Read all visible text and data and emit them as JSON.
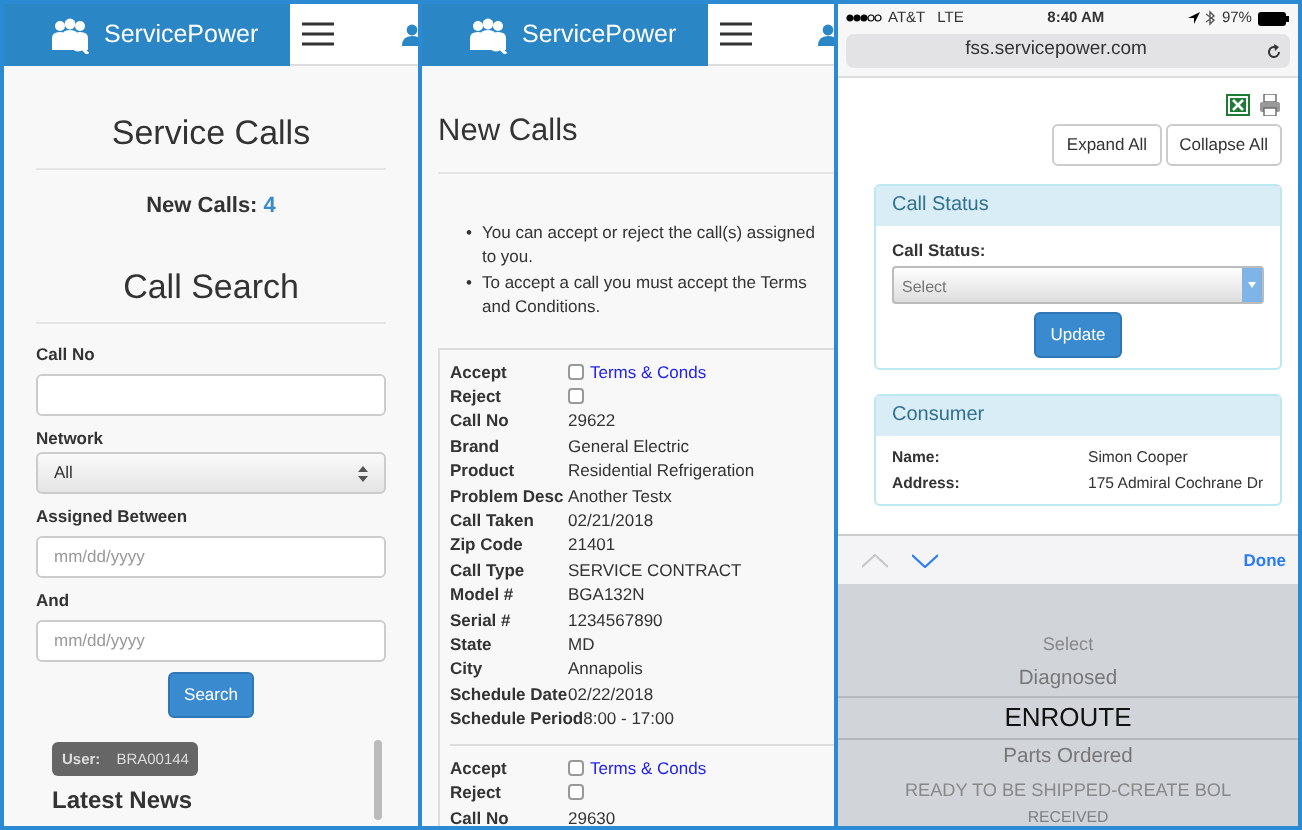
{
  "search_screen": {
    "brand": "ServicePower",
    "title": "Service Calls",
    "new_calls_label": "New Calls:",
    "new_calls_count": "4",
    "search_title": "Call Search",
    "fields": [
      {
        "kind": "text",
        "label": "Call No"
      },
      {
        "kind": "select",
        "label": "Network",
        "value": "All"
      },
      {
        "kind": "text",
        "label": "Assigned Between",
        "placeholder": "mm/dd/yyyy"
      },
      {
        "kind": "text",
        "label": "And",
        "placeholder": "mm/dd/yyyy"
      }
    ],
    "search_button": "Search",
    "user_label": "User:",
    "user_value": "BRA00144",
    "news_title": "Latest News"
  },
  "new_calls_screen": {
    "brand": "ServicePower",
    "title": "New Calls",
    "notes": [
      {
        "marker": "•",
        "text": "You can accept or reject the call(s) assigned to you."
      },
      {
        "marker": "•",
        "text": "To accept a call you must accept the Terms and Conditions."
      }
    ],
    "calls": [
      {
        "accept_label": "Accept",
        "accept_checked": false,
        "terms_link": "Terms & Conds",
        "reject_label": "Reject",
        "reject_checked": false,
        "details": [
          {
            "label": "Call No",
            "value": "29622"
          },
          {
            "label": "Brand",
            "value": "General Electric"
          },
          {
            "label": "Product",
            "value": "Residential Refrigeration"
          },
          {
            "label": "Problem Desc",
            "value": "Another Testx"
          },
          {
            "label": "Call Taken",
            "value": "02/21/2018"
          },
          {
            "label": "Zip Code",
            "value": "21401"
          },
          {
            "label": "Call Type",
            "value": "SERVICE CONTRACT"
          },
          {
            "label": "Model #",
            "value": "BGA132N"
          },
          {
            "label": "Serial #",
            "value": "1234567890"
          },
          {
            "label": "State",
            "value": "MD"
          },
          {
            "label": "City",
            "value": "Annapolis"
          },
          {
            "label": "Schedule Date",
            "value": "02/22/2018"
          },
          {
            "label": "Schedule Period",
            "value": "8:00 - 17:00"
          }
        ]
      },
      {
        "accept_label": "Accept",
        "accept_checked": false,
        "terms_link": "Terms & Conds",
        "reject_label": "Reject",
        "reject_checked": false,
        "details": [
          {
            "label": "Call No",
            "value": "29630"
          }
        ]
      }
    ]
  },
  "status_screen": {
    "carrier": "AT&T",
    "network": "LTE",
    "time": "8:40 AM",
    "battery": "97%",
    "url": "fss.servicepower.com",
    "buttons": [
      "Expand All",
      "Collapse All"
    ],
    "call_status_card": {
      "title": "Call Status",
      "label": "Call Status:",
      "select_value": "Select",
      "update_button": "Update"
    },
    "consumer_card": {
      "title": "Consumer",
      "rows": [
        {
          "label": "Name:",
          "value": "Simon Cooper"
        },
        {
          "label": "Address:",
          "value": "175 Admiral Cochrane Dr"
        }
      ]
    },
    "picker": {
      "prev_disabled": true,
      "next_disabled": false,
      "done": "Done",
      "options": [
        {
          "label": "Select",
          "selected": false
        },
        {
          "label": "Diagnosed",
          "selected": false
        },
        {
          "label": "ENROUTE",
          "selected": true
        },
        {
          "label": "Parts Ordered",
          "selected": false
        },
        {
          "label": "READY TO BE SHIPPED-CREATE BOL",
          "selected": false
        },
        {
          "label": "RECEIVED",
          "selected": false
        }
      ]
    }
  }
}
